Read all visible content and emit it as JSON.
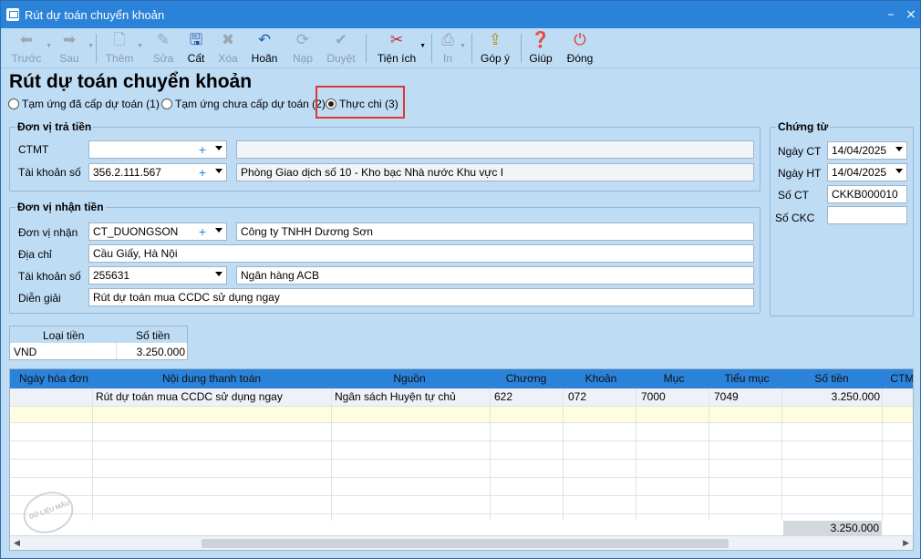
{
  "window": {
    "title": "Rút dự toán chuyển khoản",
    "minimize": "–",
    "close": "×"
  },
  "toolbar": {
    "prev": "Trước",
    "next": "Sau",
    "add": "Thêm",
    "edit": "Sửa",
    "save": "Cất",
    "delete": "Xóa",
    "undo": "Hoãn",
    "load": "Nạp",
    "approve": "Duyệt",
    "utilities": "Tiện ích",
    "print": "In",
    "feedback": "Góp ý",
    "help": "Giúp",
    "close": "Đóng"
  },
  "form": {
    "heading": "Rút dự toán chuyển khoản",
    "radio": {
      "opt1": "Tạm ứng đã cấp dự toán (1)",
      "opt2": "Tạm ứng chưa cấp dự toán (2)",
      "opt3": "Thực chi (3)",
      "selected": "opt3"
    },
    "payer": {
      "title": "Đơn vị trả tiền",
      "ctmt_label": "CTMT",
      "ctmt_value": "",
      "ctmt_desc": "",
      "account_label": "Tài khoản số",
      "account_value": "356.2.111.567",
      "account_desc": "Phòng Giao dịch số 10 - Kho bạc Nhà nước Khu vực I"
    },
    "payee": {
      "title": "Đơn vị nhận tiền",
      "unit_label": "Đơn vị nhận",
      "unit_value": "CT_DUONGSON",
      "unit_desc": "Công ty TNHH Dương Sơn",
      "address_label": "Địa chỉ",
      "address_value": "Cầu Giấy, Hà Nội",
      "account_label": "Tài khoản số",
      "account_value": "255631",
      "account_desc": "Ngân hàng ACB",
      "memo_label": "Diễn giải",
      "memo_value": "Rút dự toán mua CCDC sử dụng ngay"
    },
    "voucher": {
      "title": "Chứng từ",
      "date_label": "Ngày CT",
      "date_value": "14/04/2025",
      "post_label": "Ngày HT",
      "post_value": "14/04/2025",
      "no_label": "Số CT",
      "no_value": "CKKB000010",
      "ckc_label": "Số CKC",
      "ckc_value": ""
    },
    "currency": {
      "col_type": "Loại tiền",
      "col_amount": "Số tiền",
      "type": "VND",
      "amount": "3.250.000"
    }
  },
  "grid": {
    "columns": [
      "Ngày hóa đơn",
      "Nội dung thanh toán",
      "Nguồn",
      "Chương",
      "Khoản",
      "Mục",
      "Tiểu mục",
      "Số tiền",
      "CTMT"
    ],
    "rows": [
      [
        "",
        "Rút dự toán mua CCDC sử dụng ngay",
        "Ngân sách Huyện tự chủ",
        "622",
        "072",
        "7000",
        "7049",
        "3.250.000",
        ""
      ]
    ],
    "total": "3.250.000"
  },
  "watermark": "DỮ LIỆU MẪU",
  "colors": {
    "titlebar": "#2b82d9",
    "background": "#bfdcf5",
    "highlight": "#e03535"
  }
}
